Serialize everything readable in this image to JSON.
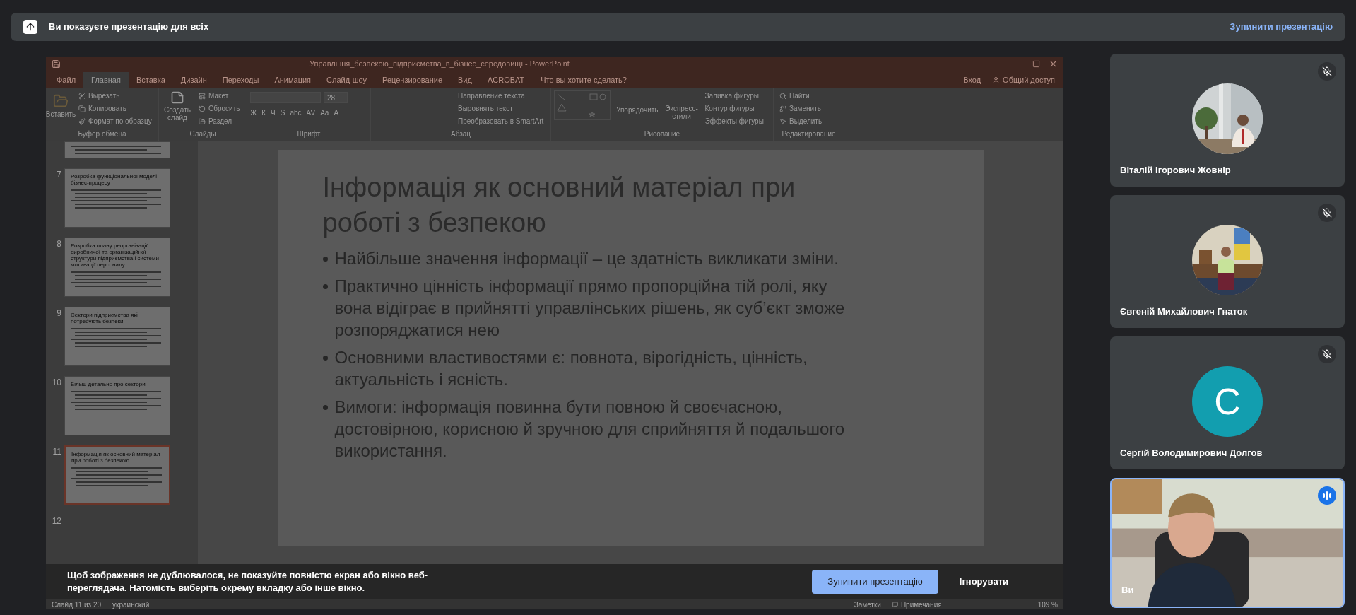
{
  "sharing_bar": {
    "message": "Ви показуєте презентацію для всіх",
    "stop_link": "Зупинити презентацію"
  },
  "powerpoint": {
    "title": "Управління_безпекою_підприємства_в_бізнес_середовищі - PowerPoint",
    "tabs": [
      {
        "label": "Файл",
        "selected": false
      },
      {
        "label": "Главная",
        "selected": true
      },
      {
        "label": "Вставка",
        "selected": false
      },
      {
        "label": "Дизайн",
        "selected": false
      },
      {
        "label": "Переходы",
        "selected": false
      },
      {
        "label": "Анимация",
        "selected": false
      },
      {
        "label": "Слайд-шоу",
        "selected": false
      },
      {
        "label": "Рецензирование",
        "selected": false
      },
      {
        "label": "Вид",
        "selected": false
      },
      {
        "label": "ACROBAT",
        "selected": false
      }
    ],
    "tell_me": "Что вы хотите сделать?",
    "sign_in": "Вход",
    "share": "Общий доступ",
    "clipboard": {
      "label": "Буфер обмена",
      "paste": "Вставить",
      "items": [
        "Вырезать",
        "Копировать",
        "Формат по образцу"
      ]
    },
    "slides": {
      "label": "Слайды",
      "new_slide": "Создать слайд",
      "items": [
        "Макет",
        "Сбросить",
        "Раздел"
      ]
    },
    "font": {
      "label": "Шрифт",
      "size": "28",
      "buttons": [
        "Ж",
        "К",
        "Ч",
        "S",
        "abc",
        "AV",
        "Aa",
        "A"
      ]
    },
    "paragraph": {
      "label": "Абзац",
      "items": [
        "Направление текста",
        "Выровнять текст",
        "Преобразовать в SmartArt"
      ]
    },
    "drawing": {
      "label": "Рисование",
      "arrange": "Упорядочить",
      "quick_styles": "Экспресс-стили",
      "items": [
        "Заливка фигуры",
        "Контур фигуры",
        "Эффекты фигуры"
      ]
    },
    "editing": {
      "label": "Редактирование",
      "items": [
        "Найти",
        "Заменить",
        "Выделить"
      ]
    },
    "thumbnails": [
      {
        "number": "7",
        "title": "Розробка функціональної моделі бізнес-процесу",
        "selected": false
      },
      {
        "number": "8",
        "title": "Розробка плану реорганізації виробничої та організаційної структури підприємства і системи мотивації персоналу",
        "selected": false
      },
      {
        "number": "9",
        "title": "Сектори підприємства які потребують безпеки",
        "selected": false
      },
      {
        "number": "10",
        "title": "Більш детально про сектори",
        "selected": false
      },
      {
        "number": "11",
        "title": "Інформація як основний матеріал при роботі з безпекою",
        "selected": true
      }
    ],
    "next_number": "12",
    "slide": {
      "title": "Інформація як основний матеріал при роботі з безпекою",
      "bullets": [
        "Найбільше значення інформації – це здатність викликати зміни.",
        "Практично цінність інформації прямо пропорційна тій ролі, яку вона відіграє в прийнятті управлінських рішень, як суб’єкт зможе розпоряджатися нею",
        "Основними властивостями  є: повнота, вірогідність, цінність, актуальність і ясність.",
        "Вимоги: інформація повинна бути повною й своєчасною, достовірною, корисною й зручною для сприйняття й подальшого використання."
      ]
    },
    "status_bar": {
      "slide_info": "Слайд 11 из 20",
      "language": "украинский",
      "notes": "Заметки",
      "comments": "Примечания",
      "zoom": "109 %"
    }
  },
  "warning": {
    "message": "Щоб зображення не дублювалося, не показуйте повністю екран або вікно веб-переглядача. Натомість виберіть окрему вкладку або інше вікно.",
    "stop_button": "Зупинити презентацію",
    "ignore_button": "Ігнорувати"
  },
  "participants": [
    {
      "name": "Віталій Ігорович Жовнір",
      "muted": true,
      "speaking": false
    },
    {
      "name": "Євгеній Михайлович Гнаток",
      "muted": true,
      "speaking": false
    },
    {
      "name": "Сергій Володимирович Долгов",
      "kind": "initial",
      "initial": "С",
      "muted": true,
      "speaking": false
    },
    {
      "name": "Ви",
      "kind": "video",
      "muted": false,
      "speaking": true
    }
  ]
}
